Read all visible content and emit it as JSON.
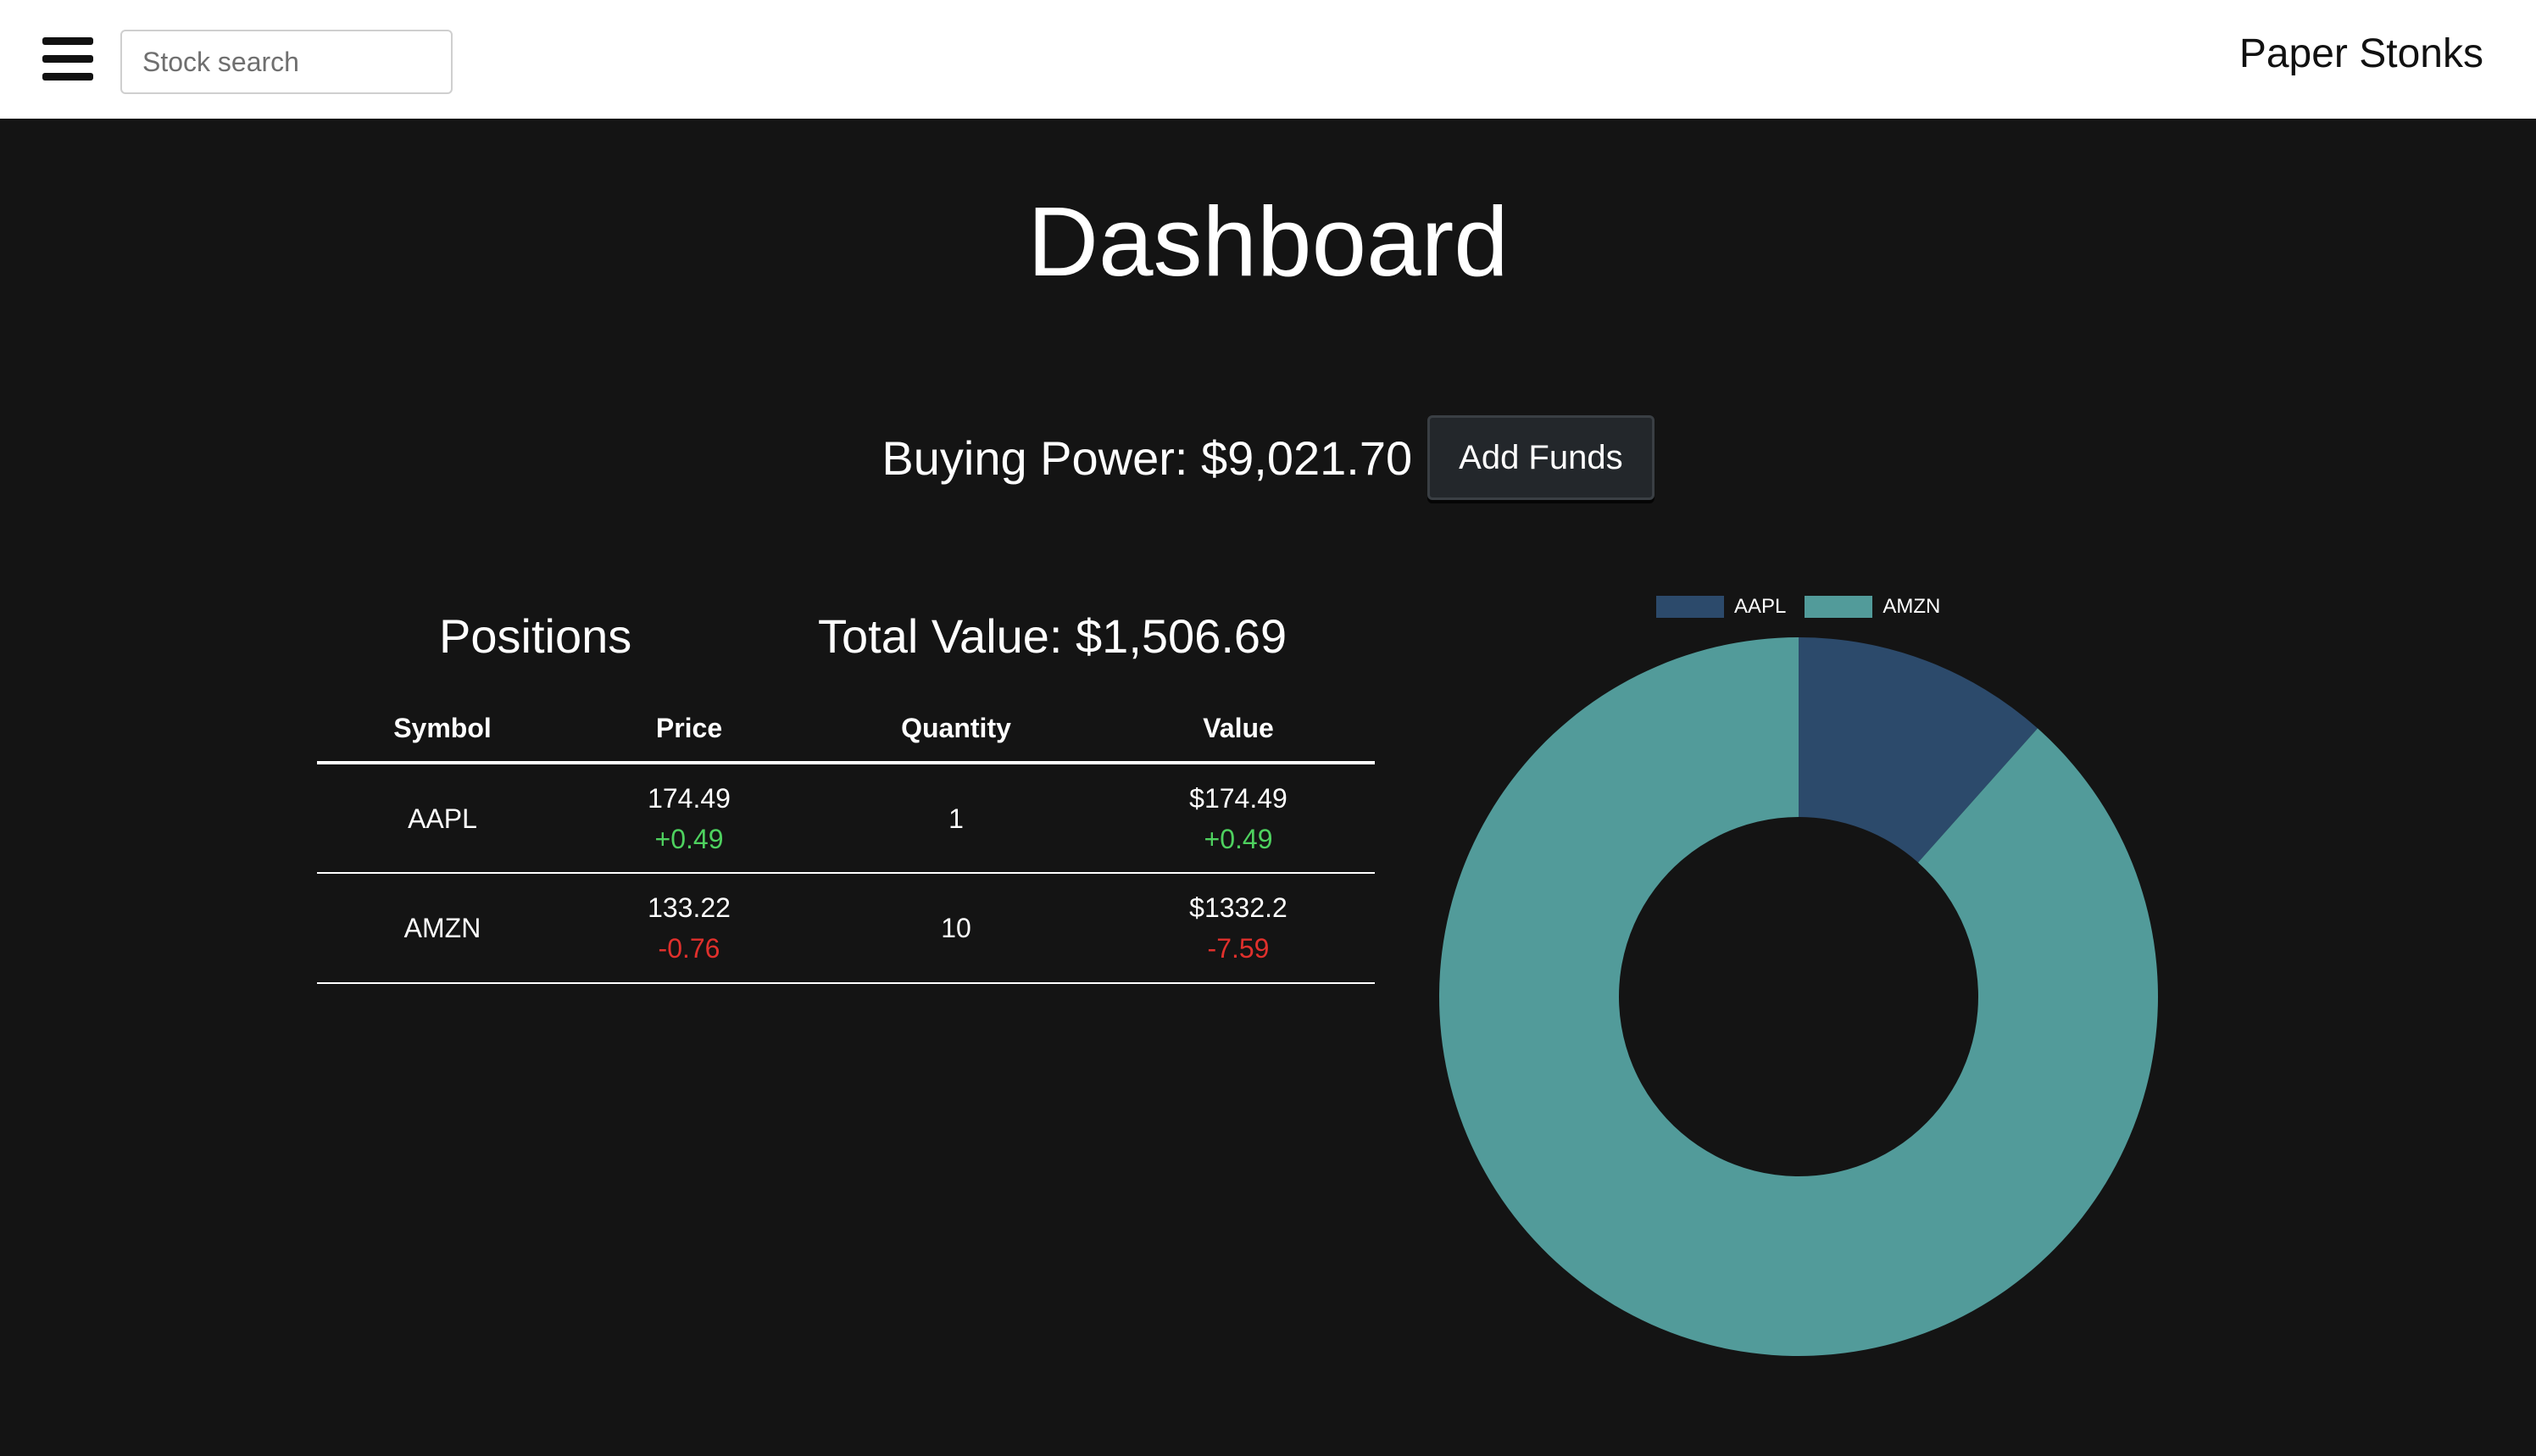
{
  "header": {
    "search_placeholder": "Stock search",
    "brand": "Paper Stonks"
  },
  "page": {
    "title": "Dashboard"
  },
  "buying_power": {
    "label": "Buying Power: $9,021.70",
    "add_funds_label": "Add Funds"
  },
  "positions": {
    "title": "Positions",
    "total_value": "Total Value: $1,506.69",
    "columns": [
      "Symbol",
      "Price",
      "Quantity",
      "Value"
    ],
    "rows": [
      {
        "symbol": "AAPL",
        "price": "174.49",
        "price_change": "+0.49",
        "quantity": "1",
        "value": "$174.49",
        "value_change": "+0.49"
      },
      {
        "symbol": "AMZN",
        "price": "133.22",
        "price_change": "-0.76",
        "quantity": "10",
        "value": "$1332.2",
        "value_change": "-7.59"
      }
    ]
  },
  "colors": {
    "up": "#4ed15f",
    "down": "#e0302c",
    "aapl": "#2c4a6b",
    "amzn": "#529b9a"
  },
  "icons": {
    "menu": "hamburger-menu-icon"
  },
  "chart_data": {
    "type": "pie",
    "variant": "doughnut",
    "categories": [
      "AAPL",
      "AMZN"
    ],
    "values": [
      174.49,
      1332.2
    ],
    "colors": [
      "#2c4a6b",
      "#529b9a"
    ],
    "legend": "top"
  }
}
